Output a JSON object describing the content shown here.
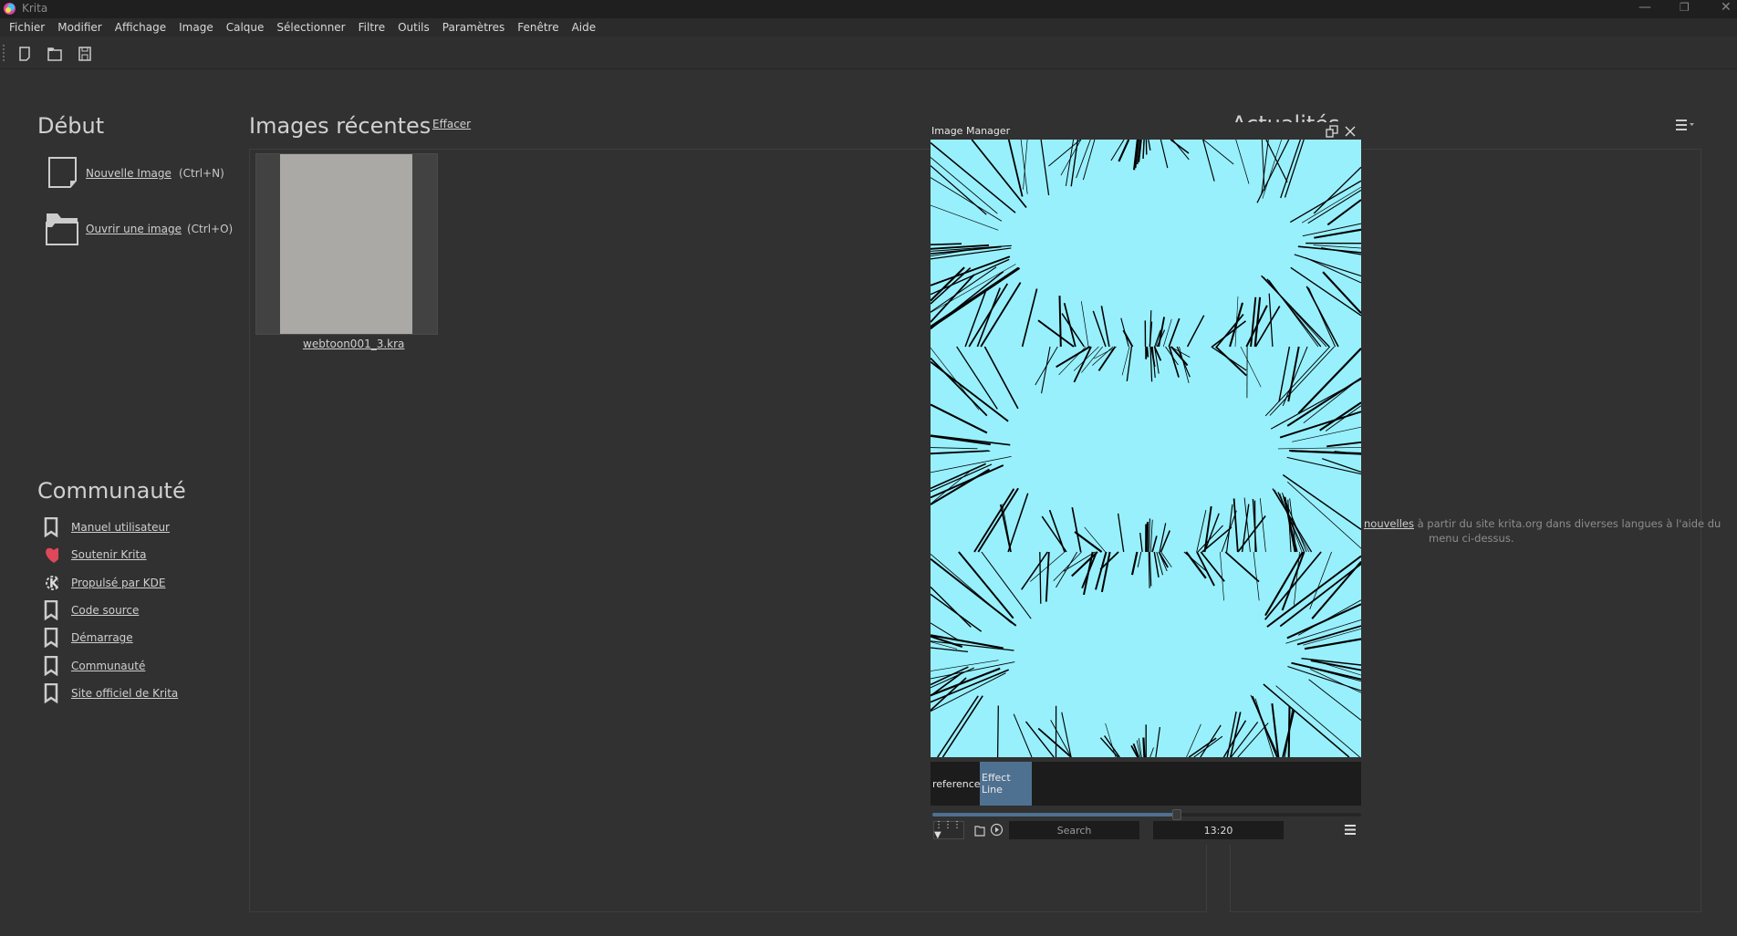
{
  "window": {
    "title": "Krita",
    "controls": [
      "minimize-icon",
      "maximize-icon",
      "close-icon"
    ]
  },
  "menu": [
    "Fichier",
    "Modifier",
    "Affichage",
    "Image",
    "Calque",
    "Sélectionner",
    "Filtre",
    "Outils",
    "Paramètres",
    "Fenêtre",
    "Aide"
  ],
  "toolbar": {
    "icons": [
      "new-document-icon",
      "open-folder-icon",
      "save-icon"
    ]
  },
  "start": {
    "title": "Début",
    "new_label": "Nouvelle Image",
    "new_shortcut": "(Ctrl+N)",
    "open_label": "Ouvrir une image",
    "open_shortcut": "(Ctrl+O)"
  },
  "recent": {
    "title": "Images récentes",
    "clear": "Effacer",
    "files": [
      {
        "name": "webtoon001_3.kra"
      }
    ]
  },
  "community": {
    "title": "Communauté",
    "items": [
      {
        "label": "Manuel utilisateur",
        "icon": "bookmark-icon"
      },
      {
        "label": "Soutenir Krita",
        "icon": "heart-icon"
      },
      {
        "label": "Propulsé par KDE",
        "icon": "kde-icon"
      },
      {
        "label": "Code source",
        "icon": "bookmark-icon"
      },
      {
        "label": "Démarrage",
        "icon": "bookmark-icon"
      },
      {
        "label": "Communauté",
        "icon": "bookmark-icon"
      },
      {
        "label": "Site officiel de Krita",
        "icon": "bookmark-icon"
      }
    ]
  },
  "news": {
    "title": "Actualités",
    "link": "nouvelles",
    "text1": " à partir du site krita.org dans diverses langues à l'aide du",
    "text2": "menu ci-dessus."
  },
  "image_manager": {
    "title": "Image Manager",
    "tabs": [
      "reference",
      "Effect Line"
    ],
    "active_tab": 1,
    "slider_value": 0.57,
    "search_placeholder": "Search",
    "time": "13:20",
    "accent": "#4f7191",
    "image_bg": "#98f0fc"
  }
}
